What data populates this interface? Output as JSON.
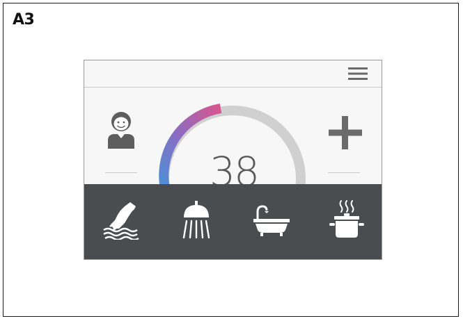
{
  "figure": {
    "label": "A3"
  },
  "dial": {
    "temperature": "38",
    "level_percent": 35
  },
  "topbar": {
    "menu_icon": "hamburger-menu-icon"
  },
  "profile": {
    "icon": "user-avatar-icon"
  },
  "controls": {
    "increase_icon": "plus-icon"
  },
  "modes": [
    {
      "name": "hand-wash",
      "icon": "hand-water-icon"
    },
    {
      "name": "shower",
      "icon": "shower-icon"
    },
    {
      "name": "bath",
      "icon": "bathtub-icon"
    },
    {
      "name": "cooking",
      "icon": "cooking-pot-icon"
    }
  ],
  "colors": {
    "background": "#f7f7f8",
    "bottom_bar": "#4a4d50",
    "gradient_start": "#4f8fd6",
    "gradient_mid": "#8a6cc2",
    "gradient_end": "#d9568f",
    "track": "#d0d0d0"
  }
}
